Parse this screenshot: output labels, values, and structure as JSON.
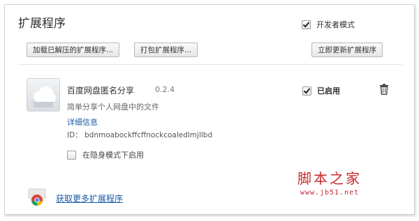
{
  "page": {
    "title": "扩展程序",
    "developer_mode_label": "开发者模式",
    "developer_mode_checked": true
  },
  "toolbar": {
    "load_unpacked_label": "加载已解压的扩展程序...",
    "pack_extension_label": "打包扩展程序...",
    "update_now_label": "立即更新扩展程序"
  },
  "extension": {
    "name": "百度网盘匿名分享",
    "version": "0.2.4",
    "description": "简单分享个人网盘中的文件",
    "details_link": "详细信息",
    "id_text": "ID： bdnmoabockffcffnockcoaledlmjllbd",
    "incognito_label": "在隐身模式下启用",
    "incognito_checked": false,
    "enabled_label": "已启用",
    "enabled_checked": true,
    "icon": "cloud-icon"
  },
  "footer": {
    "more_extensions_label": "获取更多扩展程序",
    "store_icon": "chrome-store-icon"
  },
  "watermark": {
    "main": "脚本之家",
    "url": "www.jb51.net"
  },
  "colors": {
    "link": "#1a5aa8",
    "watermark": "#c7282c"
  }
}
